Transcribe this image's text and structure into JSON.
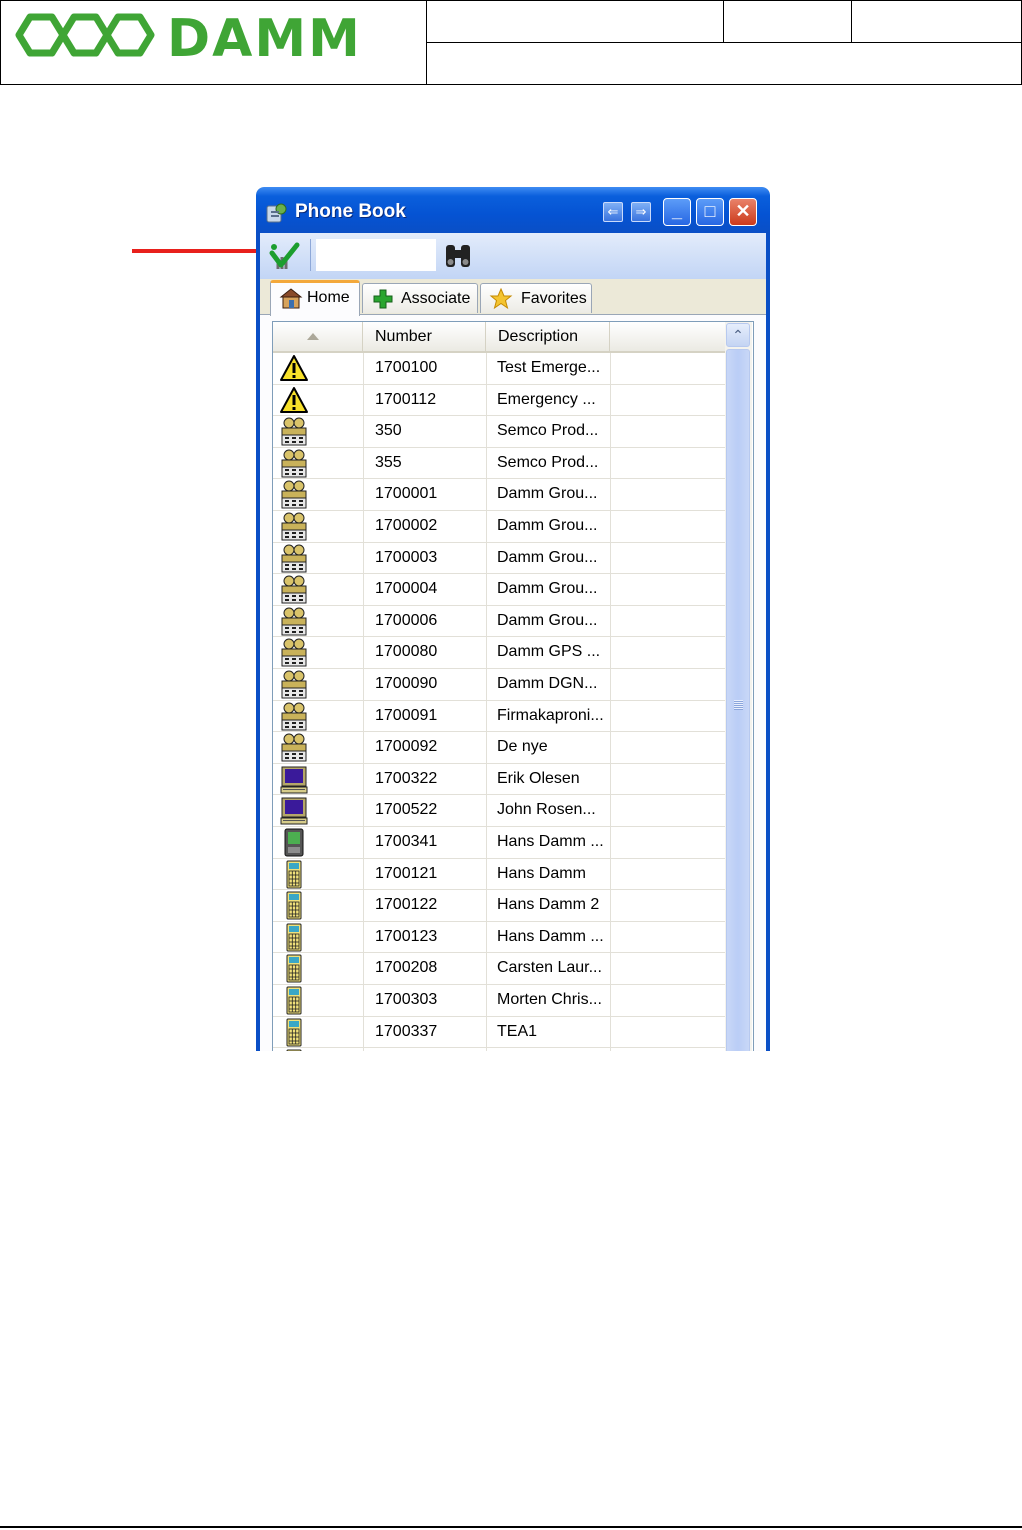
{
  "document": {
    "logo_text": "DAMM"
  },
  "window": {
    "title": "Phone Book"
  },
  "toolbar": {
    "search": {
      "value": "",
      "placeholder": ""
    },
    "icons": [
      "subscribe-check-icon",
      "binoculars-icon"
    ]
  },
  "tabs": [
    {
      "label": "Home",
      "icon": "house-icon",
      "active": true
    },
    {
      "label": "Associate",
      "icon": "green-plus-icon",
      "active": false
    },
    {
      "label": "Favorites",
      "icon": "star-icon",
      "active": false
    }
  ],
  "grid": {
    "columns": [
      "",
      "Number",
      "Description"
    ],
    "rows": [
      {
        "type": "warning",
        "number": "1700100",
        "description": "Test Emerge..."
      },
      {
        "type": "warning",
        "number": "1700112",
        "description": "Emergency ..."
      },
      {
        "type": "group",
        "number": "350",
        "description": "Semco Prod..."
      },
      {
        "type": "group",
        "number": "355",
        "description": "Semco Prod..."
      },
      {
        "type": "group",
        "number": "1700001",
        "description": "Damm Grou..."
      },
      {
        "type": "group",
        "number": "1700002",
        "description": "Damm Grou..."
      },
      {
        "type": "group",
        "number": "1700003",
        "description": "Damm Grou..."
      },
      {
        "type": "group",
        "number": "1700004",
        "description": "Damm Grou..."
      },
      {
        "type": "group",
        "number": "1700006",
        "description": "Damm Grou..."
      },
      {
        "type": "group",
        "number": "1700080",
        "description": "Damm GPS ..."
      },
      {
        "type": "group",
        "number": "1700090",
        "description": "Damm DGN..."
      },
      {
        "type": "group",
        "number": "1700091",
        "description": "Firmakaproni..."
      },
      {
        "type": "group",
        "number": "1700092",
        "description": "De nye"
      },
      {
        "type": "console",
        "number": "1700322",
        "description": "Erik Olesen"
      },
      {
        "type": "console",
        "number": "1700522",
        "description": "John Rosen..."
      },
      {
        "type": "mobile-green",
        "number": "1700341",
        "description": "Hans Damm ..."
      },
      {
        "type": "handset",
        "number": "1700121",
        "description": "Hans Damm"
      },
      {
        "type": "handset",
        "number": "1700122",
        "description": "Hans Damm 2"
      },
      {
        "type": "handset",
        "number": "1700123",
        "description": "Hans Damm ..."
      },
      {
        "type": "handset",
        "number": "1700208",
        "description": "Carsten Laur..."
      },
      {
        "type": "handset",
        "number": "1700303",
        "description": "Morten Chris..."
      },
      {
        "type": "handset",
        "number": "1700337",
        "description": "TEA1"
      }
    ]
  },
  "colors": {
    "title_bar": "#0553d3",
    "logo_green": "#3fa535",
    "arrow_red": "#e8201c",
    "tab_accent": "#f3a83b"
  }
}
